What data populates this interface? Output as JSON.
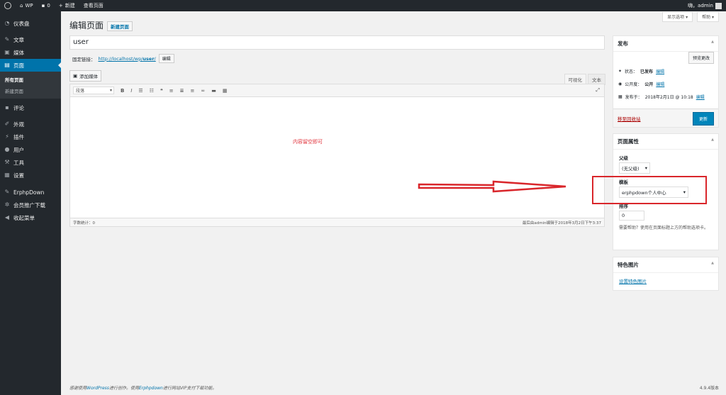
{
  "adminbar": {
    "site_name": "WP",
    "comments_count": "0",
    "new_label": "新建",
    "view_page_label": "查看页面",
    "greeting": "嗨，admin"
  },
  "sidebar": {
    "items": [
      {
        "label": "仪表盘",
        "icon": "dashboard-icon"
      },
      {
        "label": "文章",
        "icon": "pin-icon"
      },
      {
        "label": "媒体",
        "icon": "media-icon"
      },
      {
        "label": "页面",
        "icon": "pages-icon"
      },
      {
        "label": "评论",
        "icon": "comment-icon"
      },
      {
        "label": "外观",
        "icon": "appearance-icon"
      },
      {
        "label": "插件",
        "icon": "plugin-icon"
      },
      {
        "label": "用户",
        "icon": "user-icon"
      },
      {
        "label": "工具",
        "icon": "wrench-icon"
      },
      {
        "label": "设置",
        "icon": "settings-icon"
      },
      {
        "label": "ErphpDown",
        "icon": "erphpdown-icon"
      },
      {
        "label": "会员推广下载",
        "icon": "gear-icon"
      },
      {
        "label": "收起菜单",
        "icon": "collapse-icon"
      }
    ],
    "submenu": [
      "所有页面",
      "新建页面"
    ]
  },
  "screen_options": {
    "screen_options_label": "显示选项 ▾",
    "help_label": "帮助 ▾"
  },
  "page": {
    "heading": "编辑页面",
    "add_new_label": "新建页面",
    "title_value": "user",
    "permalink_label": "固定链接：",
    "permalink_url_prefix": "http://localhost/wp/",
    "permalink_slug": "user",
    "permalink_suffix": "/",
    "edit_button": "编辑"
  },
  "editor": {
    "add_media": "添加媒体",
    "tab_visual": "可视化",
    "tab_text": "文本",
    "format_select": "段落",
    "content_note": "内容留空即可",
    "word_count": "字数统计：0",
    "last_edited": "最后由admin编辑于2018年3月2日下午3:37"
  },
  "publish_box": {
    "title": "发布",
    "preview_button": "预览更改",
    "status_label": "状态：",
    "status_value": "已发布",
    "visibility_label": "公开度：",
    "visibility_value": "公开",
    "published_label": "发布于：",
    "published_value": "2018年2月1日 @ 10:18",
    "edit_link": "编辑",
    "trash_link": "移至回收站",
    "update_button": "更新"
  },
  "attributes_box": {
    "title": "页面属性",
    "parent_label": "父级",
    "parent_value": "(无父级)",
    "template_label": "模板",
    "template_value": "erphpdown个人中心",
    "order_label": "排序",
    "order_value": "0",
    "help_text": "需要帮助？使用在页面标题上方的帮助选项卡。"
  },
  "featured_box": {
    "title": "特色图片",
    "set_link": "设置特色图片"
  },
  "footer": {
    "thanks_prefix": "感谢使用",
    "wp_link": "WordPress",
    "thanks_mid": "进行创作。使用",
    "erphp_link": "Erphpdown",
    "thanks_suffix": "进行网站VIP支付下载功能。",
    "version": "4.9.4版本"
  },
  "colors": {
    "accent": "#0073aa",
    "annotation": "#d9262b",
    "adminbar": "#23282d"
  }
}
